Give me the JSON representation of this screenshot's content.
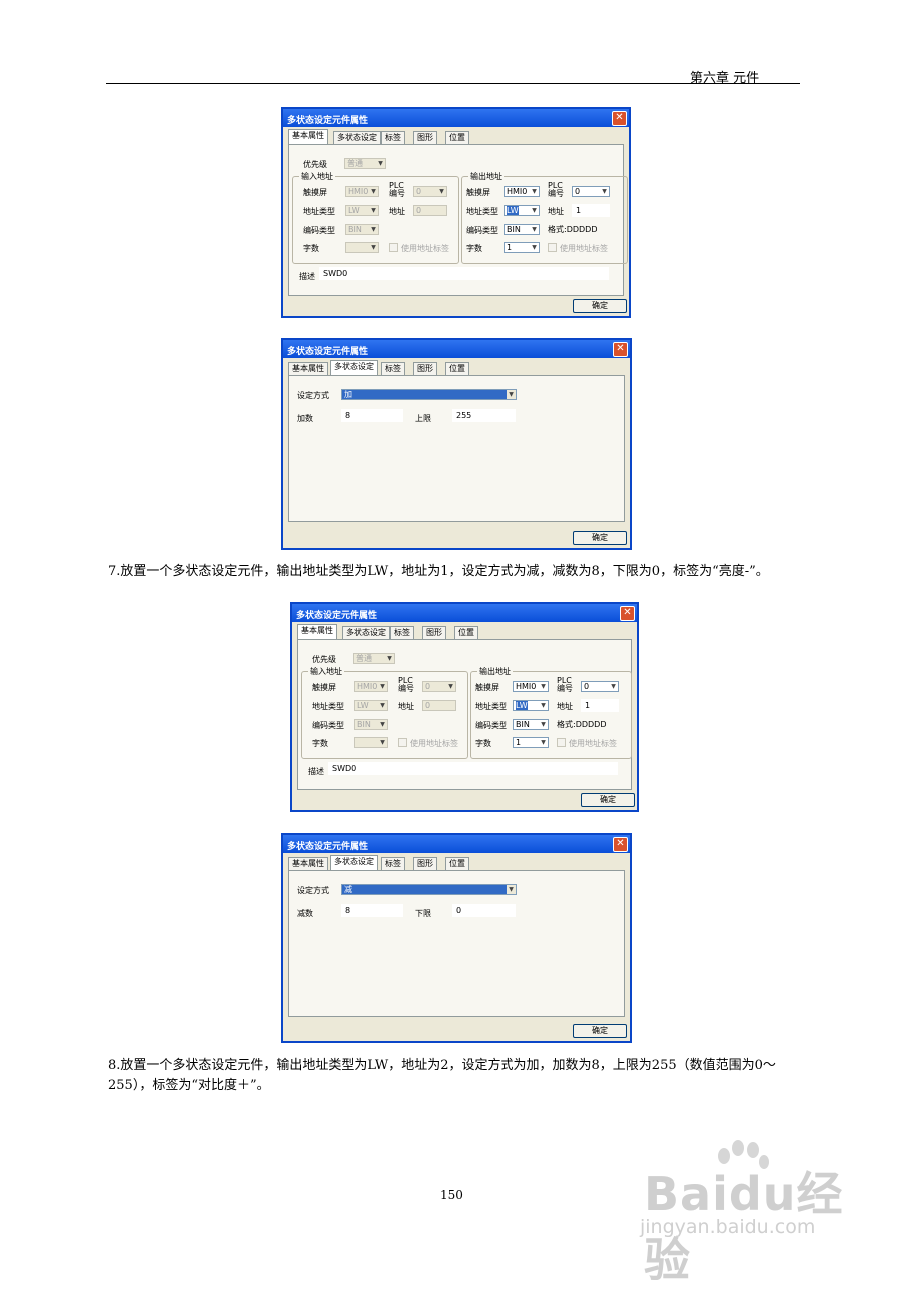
{
  "header": {
    "chapter": "第六章 元件"
  },
  "paragraphs": {
    "p7": "7.放置一个多状态设定元件，输出地址类型为LW，地址为1，设定方式为减，减数为8，下限为0，标签为“亮度-”。",
    "p8": "8.放置一个多状态设定元件，输出地址类型为LW，地址为2，设定方式为加，加数为8，上限为255（数值范围为0～255），标签为“对比度＋”。"
  },
  "page_number": "150",
  "watermark": {
    "brand": "Baidu经验",
    "url": "jingyan.baidu.com"
  },
  "dialog_common": {
    "title": "多状态设定元件属性",
    "close": "✕",
    "tabs": [
      "基本属性",
      "多状态设定",
      "标签",
      "图形",
      "位置"
    ],
    "ok": "确定"
  },
  "basic": {
    "priority_label": "优先级",
    "priority_value": "普通",
    "input_group": "输入地址",
    "output_group": "输出地址",
    "touch_label": "触摸屏",
    "plc_label": "PLC\n编号",
    "addr_type_label": "地址类型",
    "addr_label": "地址",
    "encode_label": "编码类型",
    "words_label": "字数",
    "use_tag_label": "使用地址标签",
    "in_hmi": "HMI0",
    "in_plc": "0",
    "in_type": "LW",
    "in_addr": "0",
    "in_encode": "BIN",
    "in_words": "",
    "out_hmi": "HMI0",
    "out_plc": "0",
    "out_type": "LW",
    "out_encode": "BIN",
    "out_words": "1",
    "format_label": "格式:DDDDD",
    "desc_label": "描述",
    "desc_value": "SWD0"
  },
  "dialogs": {
    "d1": {
      "out_addr": "1"
    },
    "d2": {
      "mode_label": "设定方式",
      "mode": "加",
      "step_label": "加数",
      "step": "8",
      "limit_label": "上限",
      "limit": "255"
    },
    "d3": {
      "out_addr": "1"
    },
    "d4": {
      "mode_label": "设定方式",
      "mode": "减",
      "step_label": "减数",
      "step": "8",
      "limit_label": "下限",
      "limit": "0"
    }
  }
}
